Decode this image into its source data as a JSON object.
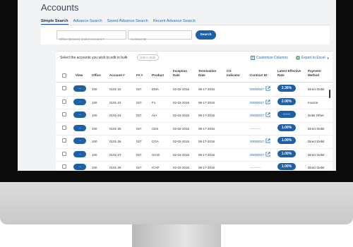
{
  "page": {
    "title": "Accounts"
  },
  "tabs": [
    {
      "label": "Simple Search",
      "active": true
    },
    {
      "label": "Advance Search",
      "active": false
    },
    {
      "label": "Saved Advance Search",
      "active": false
    },
    {
      "label": "Recent Advance Search",
      "active": false
    }
  ],
  "search": {
    "office_placeholder": "Office (Branch) and/or Account #",
    "contract_placeholder": "Contract ID",
    "button_label": "Search"
  },
  "bulk": {
    "instruction": "Select the accounts you wish to edit in bulk",
    "edit_button": "Edit in Bulk",
    "customize_label": "Customize Columns",
    "export_label": "Export to Excel"
  },
  "table": {
    "headers": {
      "view": "View",
      "office": "Office",
      "account": "Account #",
      "fa": "FA #",
      "product": "Product",
      "inception": [
        "Inception",
        "Date"
      ],
      "termination": [
        "Termination",
        "Date"
      ],
      "cg": [
        "CG",
        "Indicator"
      ],
      "contract": "Contract ID",
      "rate": [
        "Latest Effective",
        "Rate"
      ],
      "payment": [
        "Payment",
        "Method"
      ]
    },
    "rows": [
      {
        "office": "100",
        "account": "0101-22",
        "fa": "027",
        "product": "EMA",
        "inception": "02-02-2016",
        "termination": "06-17-2016",
        "contract": "00000027",
        "rate": "2.36%",
        "payment": "Direct Debit"
      },
      {
        "office": "100",
        "account": "0101-23",
        "fa": "027",
        "product": "F1",
        "inception": "02-02-2016",
        "termination": "06-17-2016",
        "contract": "00000027",
        "rate": "2.00%",
        "payment": "Invoice"
      },
      {
        "office": "100",
        "account": "0101-24",
        "fa": "027",
        "product": "AIA",
        "inception": "02-02-2016",
        "termination": "06-17-2016",
        "contract": "00000027",
        "rate": "------",
        "payment": "Debit Other"
      },
      {
        "office": "100",
        "account": "0101-25",
        "fa": "027",
        "product": "CES",
        "inception": "02-02-2016",
        "termination": "06-17-2016",
        "contract": "----------",
        "rate": "1.00%",
        "payment": "Direct Debit"
      },
      {
        "office": "100",
        "account": "0101-26",
        "fa": "027",
        "product": "CGA",
        "inception": "02-02-2016",
        "termination": "06-17-2016",
        "contract": "00000027",
        "rate": "1.00%",
        "payment": "Direct Debit"
      },
      {
        "office": "100",
        "account": "0101-27",
        "fa": "027",
        "product": "GCGI",
        "inception": "02-02-2016",
        "termination": "06-17-2016",
        "contract": "00000027",
        "rate": "1.00%",
        "payment": "Direct Debit"
      },
      {
        "office": "100",
        "account": "0101-28",
        "fa": "027",
        "product": "ICAP",
        "inception": "02-02-2016",
        "termination": "06-17-2016",
        "contract": "----------",
        "rate": "1.00%",
        "payment": "Direct Debit"
      }
    ],
    "view_glyph": "→"
  },
  "icons": {
    "customize": "columns-icon",
    "export": "excel-icon",
    "export_caret": "▼",
    "link": "external-link-icon"
  },
  "colors": {
    "primary": "#1f5fa6",
    "link": "#2a67b0",
    "text": "#2a333b"
  }
}
